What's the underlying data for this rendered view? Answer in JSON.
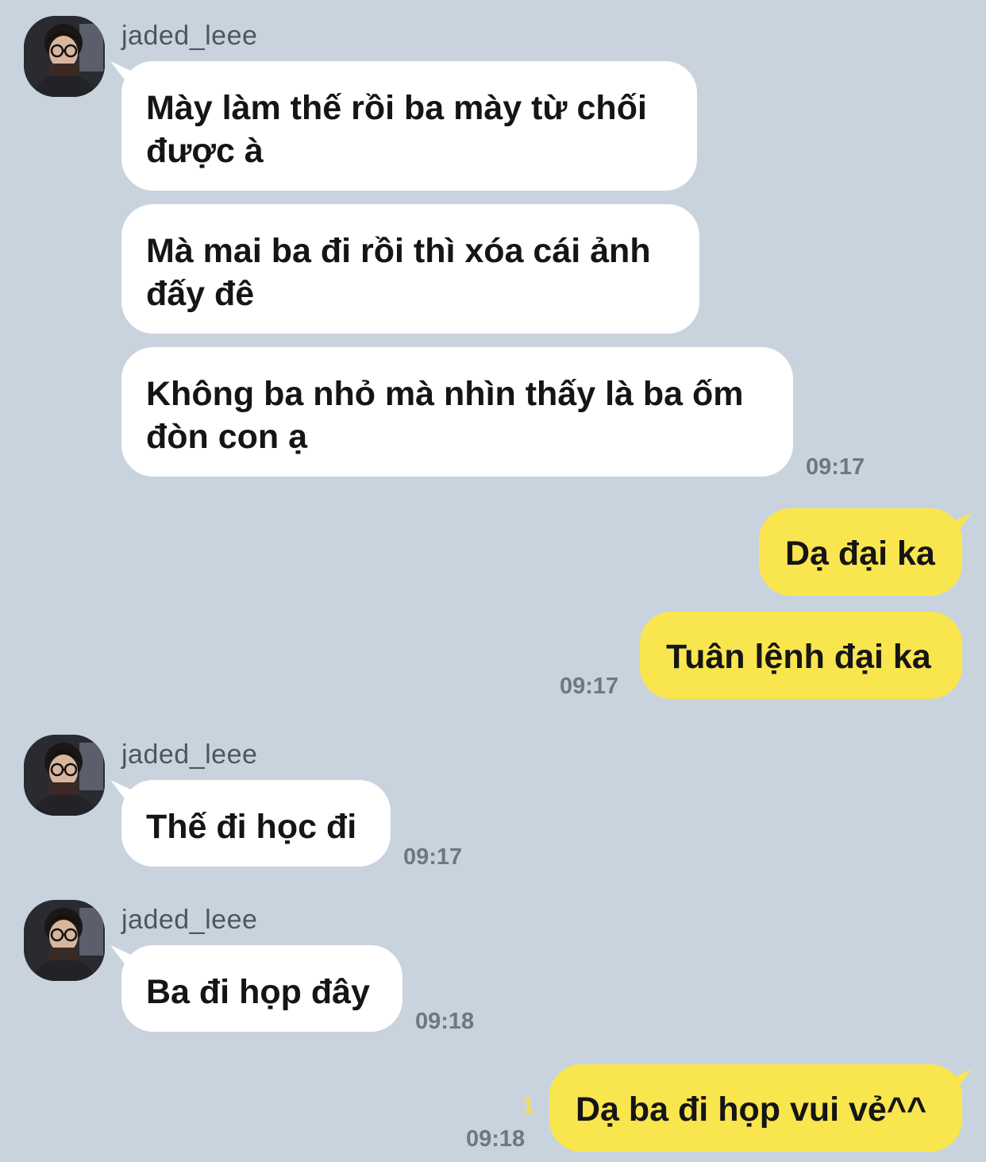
{
  "colors": {
    "background": "#c9d3de",
    "incoming_bubble": "#ffffff",
    "outgoing_bubble": "#f9e54e",
    "unread_count": "#f3e04a"
  },
  "conversation": {
    "groups": [
      {
        "sender": "jaded_leee",
        "avatar_icon": "profile-photo-avatar",
        "messages": [
          "Mày làm thế rồi ba mày từ chối được à",
          "Mà mai ba đi rồi thì xóa cái ảnh đấy đê",
          "Không ba nhỏ mà nhìn thấy là ba ốm đòn con ạ"
        ],
        "time": "09:17"
      },
      {
        "sender": "me",
        "messages": [
          "Dạ đại ka",
          "Tuân lệnh đại ka"
        ],
        "time": "09:17"
      },
      {
        "sender": "jaded_leee",
        "avatar_icon": "profile-photo-avatar",
        "messages": [
          "Thế đi học đi"
        ],
        "time": "09:17"
      },
      {
        "sender": "jaded_leee",
        "avatar_icon": "profile-photo-avatar",
        "messages": [
          "Ba đi họp đây"
        ],
        "time": "09:18"
      },
      {
        "sender": "me",
        "messages": [
          "Dạ ba đi họp vui vẻ^^"
        ],
        "time": "09:18",
        "unread": "1"
      }
    ]
  }
}
